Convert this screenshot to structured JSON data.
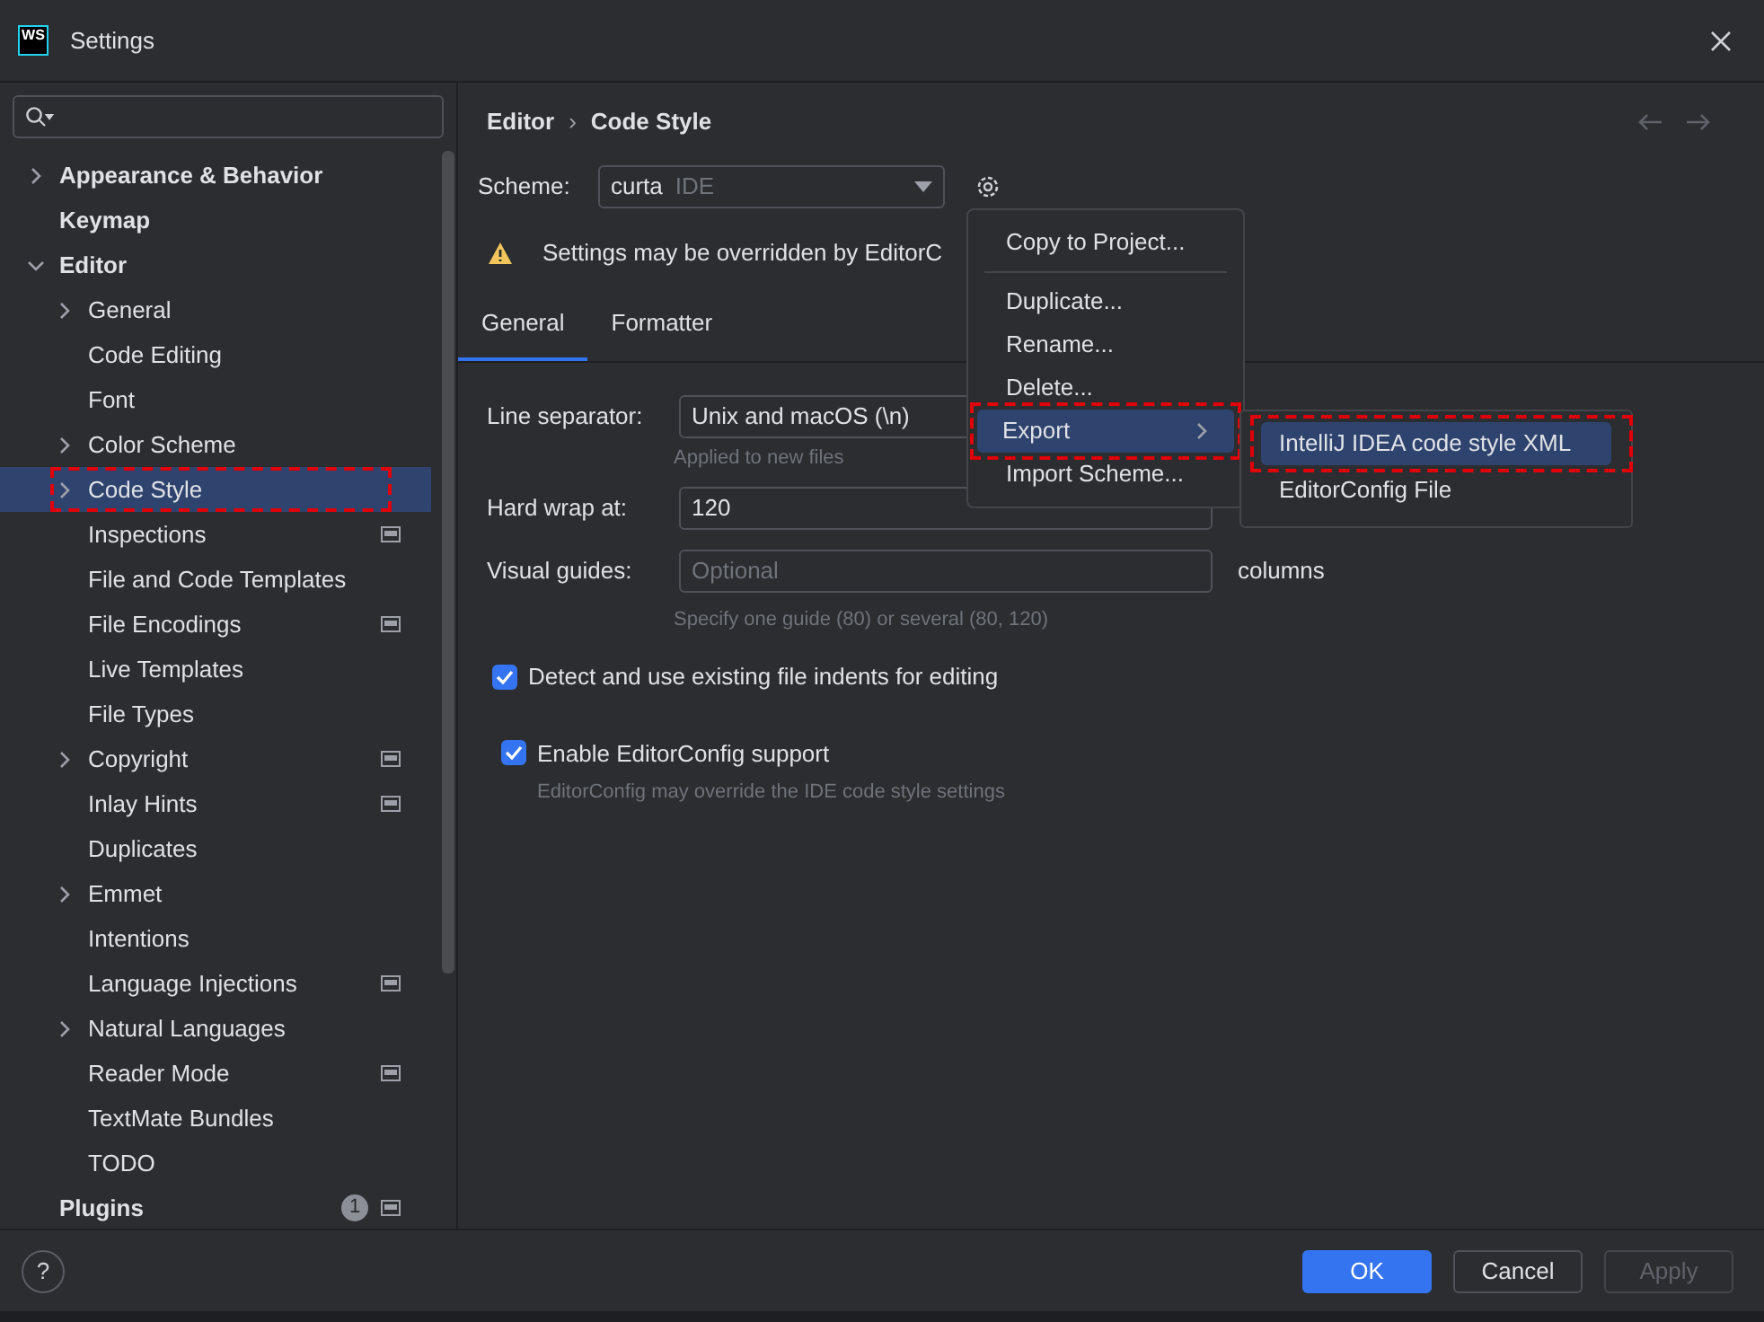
{
  "window": {
    "title": "Settings",
    "logo": "WS"
  },
  "sidebar": {
    "items": [
      {
        "label": "Appearance & Behavior",
        "expandable": true,
        "expanded": false,
        "selected": false,
        "highlighted": false,
        "project_scope": false
      },
      {
        "label": "Keymap",
        "expandable": false,
        "selected": false,
        "highlighted": false,
        "project_scope": false
      },
      {
        "label": "Editor",
        "expandable": true,
        "expanded": true,
        "selected": false,
        "highlighted": false,
        "project_scope": false,
        "children": [
          {
            "label": "General",
            "expandable": true,
            "expanded": false,
            "selected": false,
            "highlighted": false,
            "project_scope": false
          },
          {
            "label": "Code Editing",
            "expandable": false,
            "selected": false,
            "highlighted": false,
            "project_scope": false
          },
          {
            "label": "Font",
            "expandable": false,
            "selected": false,
            "highlighted": false,
            "project_scope": false
          },
          {
            "label": "Color Scheme",
            "expandable": true,
            "expanded": false,
            "selected": false,
            "highlighted": false,
            "project_scope": false
          },
          {
            "label": "Code Style",
            "expandable": true,
            "expanded": false,
            "selected": true,
            "highlighted": true,
            "project_scope": false
          },
          {
            "label": "Inspections",
            "expandable": false,
            "selected": false,
            "highlighted": false,
            "project_scope": true
          },
          {
            "label": "File and Code Templates",
            "expandable": false,
            "selected": false,
            "highlighted": false,
            "project_scope": false
          },
          {
            "label": "File Encodings",
            "expandable": false,
            "selected": false,
            "highlighted": false,
            "project_scope": true
          },
          {
            "label": "Live Templates",
            "expandable": false,
            "selected": false,
            "highlighted": false,
            "project_scope": false
          },
          {
            "label": "File Types",
            "expandable": false,
            "selected": false,
            "highlighted": false,
            "project_scope": false
          },
          {
            "label": "Copyright",
            "expandable": true,
            "expanded": false,
            "selected": false,
            "highlighted": false,
            "project_scope": true
          },
          {
            "label": "Inlay Hints",
            "expandable": false,
            "selected": false,
            "highlighted": false,
            "project_scope": true
          },
          {
            "label": "Duplicates",
            "expandable": false,
            "selected": false,
            "highlighted": false,
            "project_scope": false
          },
          {
            "label": "Emmet",
            "expandable": true,
            "expanded": false,
            "selected": false,
            "highlighted": false,
            "project_scope": false
          },
          {
            "label": "Intentions",
            "expandable": false,
            "selected": false,
            "highlighted": false,
            "project_scope": false
          },
          {
            "label": "Language Injections",
            "expandable": false,
            "selected": false,
            "highlighted": false,
            "project_scope": true
          },
          {
            "label": "Natural Languages",
            "expandable": true,
            "expanded": false,
            "selected": false,
            "highlighted": false,
            "project_scope": false
          },
          {
            "label": "Reader Mode",
            "expandable": false,
            "selected": false,
            "highlighted": false,
            "project_scope": true
          },
          {
            "label": "TextMate Bundles",
            "expandable": false,
            "selected": false,
            "highlighted": false,
            "project_scope": false
          },
          {
            "label": "TODO",
            "expandable": false,
            "selected": false,
            "highlighted": false,
            "project_scope": false
          }
        ]
      },
      {
        "label": "Plugins",
        "expandable": false,
        "selected": false,
        "highlighted": false,
        "project_scope": true,
        "badge": "1"
      }
    ]
  },
  "breadcrumb": [
    "Editor",
    "›",
    "Code Style"
  ],
  "help": "?",
  "scheme": {
    "label": "Scheme:",
    "value": "curta",
    "tag": "IDE"
  },
  "warning": "Settings may be overridden by EditorC",
  "tabs": [
    {
      "label": "General",
      "selected": true
    },
    {
      "label": "Formatter",
      "selected": false
    }
  ],
  "form": {
    "line_separator": {
      "label": "Line separator:",
      "value": "Unix and macOS (\\n)",
      "hint": "Applied to new files"
    },
    "hard_wrap": {
      "label": "Hard wrap at:",
      "value": "120"
    },
    "visual_guides": {
      "label": "Visual guides:",
      "placeholder": "Optional",
      "suffix": "columns",
      "hint": "Specify one guide (80) or several (80, 120)"
    },
    "checkboxes": [
      {
        "label": "Detect and use existing file indents for editing",
        "checked": true
      },
      {
        "label": "Enable EditorConfig support",
        "checked": true,
        "hint": "EditorConfig may override the IDE code style settings"
      }
    ]
  },
  "menu": {
    "items": [
      {
        "kind": "item",
        "label": "Copy to Project...",
        "selected": false,
        "highlighted": false
      },
      {
        "kind": "separator"
      },
      {
        "kind": "item",
        "label": "Duplicate...",
        "selected": false,
        "highlighted": false
      },
      {
        "kind": "item",
        "label": "Rename...",
        "selected": false,
        "highlighted": false
      },
      {
        "kind": "item",
        "label": "Delete...",
        "selected": false,
        "highlighted": false
      },
      {
        "kind": "submenu",
        "label": "Export",
        "selected": true,
        "highlighted": true
      },
      {
        "kind": "item",
        "label": "Import Scheme...",
        "selected": false,
        "highlighted": false
      }
    ]
  },
  "submenu": {
    "items": [
      {
        "label": "IntelliJ IDEA code style XML",
        "selected": true,
        "highlighted": true
      },
      {
        "label": "EditorConfig File",
        "selected": false,
        "highlighted": false
      }
    ]
  },
  "buttons": [
    {
      "label": "OK",
      "default": true,
      "disabled": false
    },
    {
      "label": "Cancel",
      "default": false,
      "disabled": false
    },
    {
      "label": "Apply",
      "default": false,
      "disabled": true
    }
  ]
}
